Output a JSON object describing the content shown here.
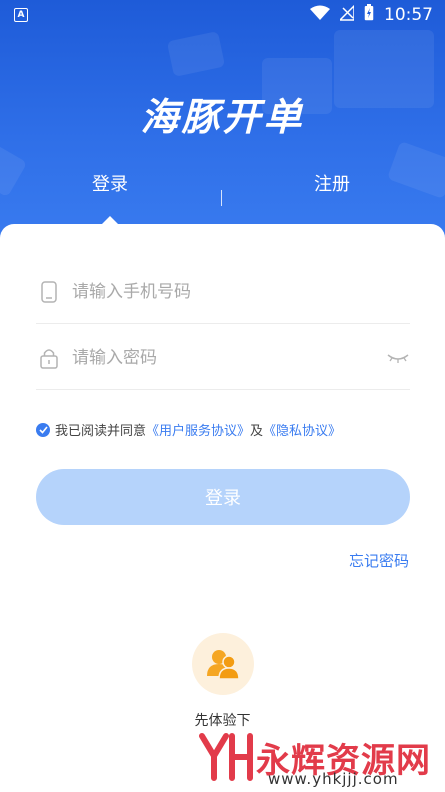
{
  "status_bar": {
    "time": "10:57",
    "left_icon_letter": "A"
  },
  "app": {
    "title": "海豚开单"
  },
  "tabs": {
    "login": "登录",
    "register": "注册",
    "divider": "|"
  },
  "form": {
    "phone_placeholder": "请输入手机号码",
    "password_placeholder": "请输入密码"
  },
  "agreement": {
    "prefix": "我已阅读并同意",
    "user_agreement": "《用户服务协议》",
    "and": "及",
    "privacy": "《隐私协议》",
    "checked": true
  },
  "login_button": "登录",
  "forgot_password": "忘记密码",
  "guest": {
    "label": "先体验下"
  },
  "watermark": {
    "brand": "永辉资源网",
    "url": "www.yhkjjj.com"
  },
  "colors": {
    "primary": "#3a7cf0",
    "header": "#1e5bd8",
    "button_disabled": "#b5d3fb",
    "guest_bg": "#fdf0dc",
    "guest_icon": "#f5a623",
    "watermark": "#e23b4a"
  },
  "icons": [
    "phone-icon",
    "lock-icon",
    "eye-closed-icon",
    "check-icon",
    "guest-users-icon",
    "wifi-icon",
    "signal-icon",
    "battery-icon"
  ]
}
